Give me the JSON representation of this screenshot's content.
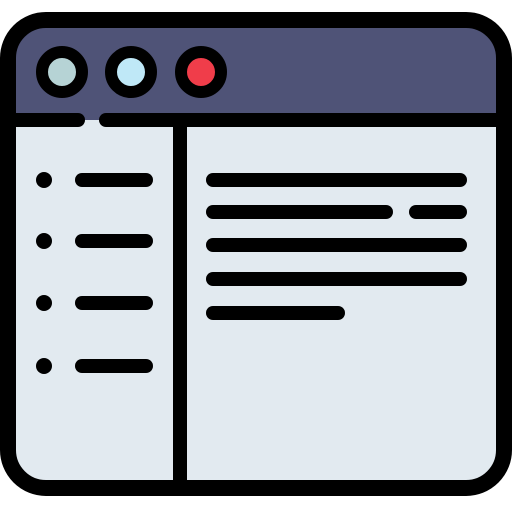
{
  "icon": {
    "kind": "browser-window-icon",
    "colors": {
      "outline": "#000000",
      "title_bar": "#4F5377",
      "window_body": "#E2EAF0",
      "sidebar_panel": "#E2EAF0",
      "dot_1": "#B6D3D5",
      "dot_2": "#BFE8F7",
      "dot_3": "#F03D4A",
      "highlight": "#FFFFFF"
    },
    "title_bar_dots": [
      {
        "name": "window-dot-1",
        "color": "#B6D3D5"
      },
      {
        "name": "window-dot-2",
        "color": "#BFE8F7"
      },
      {
        "name": "window-dot-3",
        "color": "#F03D4A"
      }
    ],
    "sidebar_items": 4,
    "content_lines": 5
  }
}
